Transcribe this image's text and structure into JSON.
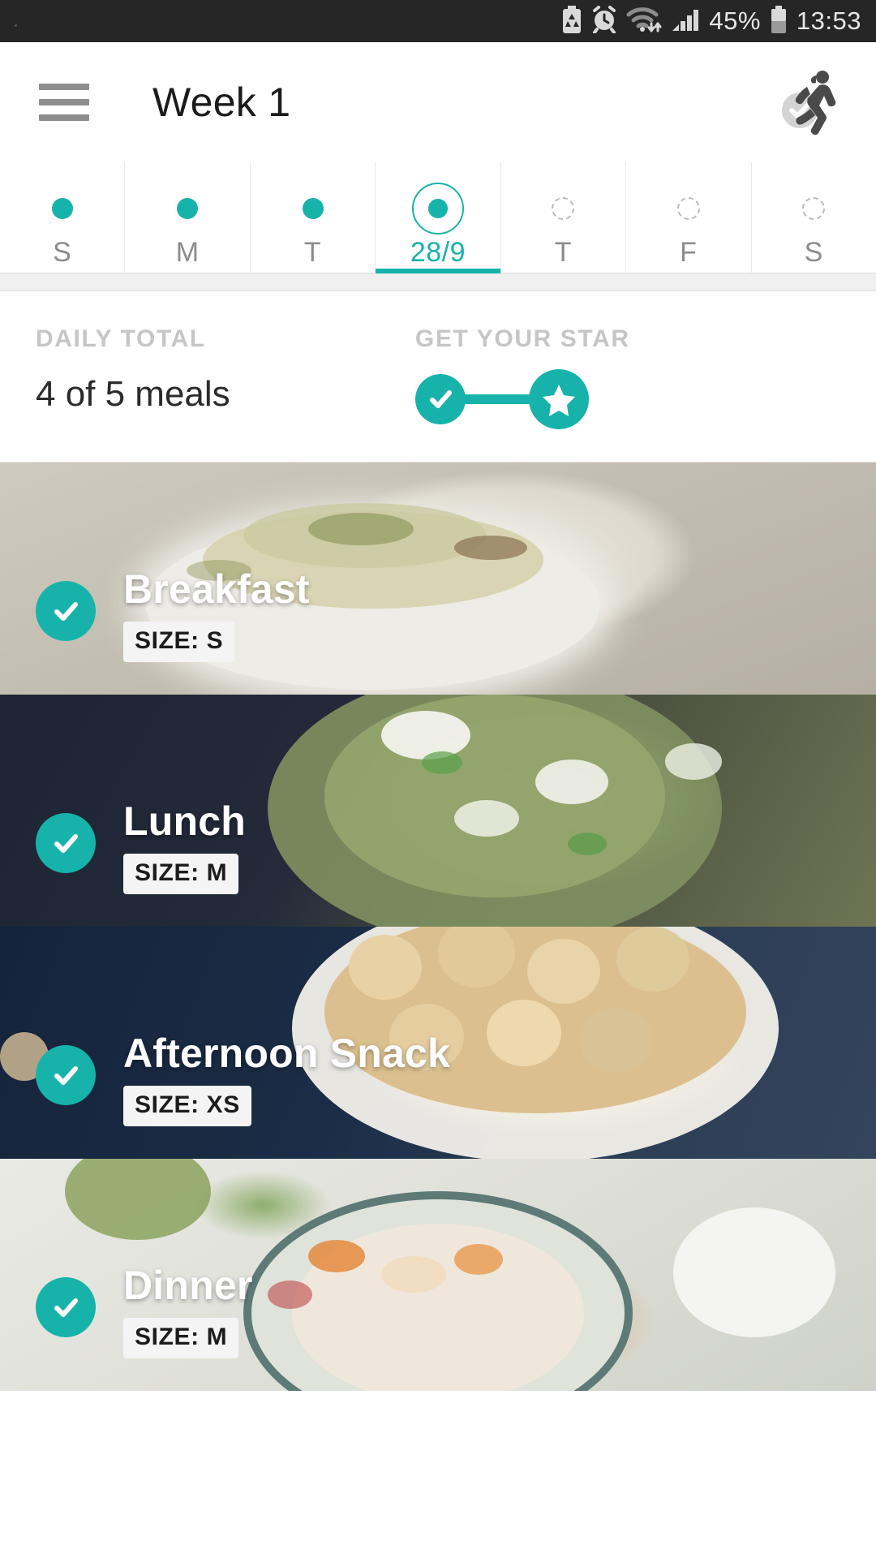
{
  "status_bar": {
    "icons": [
      "battery-saver-icon",
      "alarm-clock-icon",
      "wifi-icon",
      "signal-bars-icon",
      "battery-icon"
    ],
    "battery_percent": "45%",
    "time": "13:53"
  },
  "app_bar": {
    "menu_icon": "hamburger-menu-icon",
    "title": "Week 1",
    "action_icon": "running-person-icon"
  },
  "week_strip": {
    "days": [
      {
        "label": "S",
        "state": "complete",
        "selected": false
      },
      {
        "label": "M",
        "state": "complete",
        "selected": false
      },
      {
        "label": "T",
        "state": "complete",
        "selected": false
      },
      {
        "label": "28/9",
        "state": "complete",
        "selected": true
      },
      {
        "label": "T",
        "state": "empty",
        "selected": false
      },
      {
        "label": "F",
        "state": "empty",
        "selected": false
      },
      {
        "label": "S",
        "state": "empty",
        "selected": false
      }
    ]
  },
  "summary": {
    "daily_total_label": "DAILY TOTAL",
    "daily_total_value": "4 of 5 meals",
    "star_label": "GET YOUR STAR",
    "star_progress_icons": [
      "check-circle-icon",
      "star-circle-icon"
    ]
  },
  "meals": [
    {
      "name": "Breakfast",
      "size": "SIZE: S",
      "checked": true,
      "photo": "zucchini-gratin-photo"
    },
    {
      "name": "Lunch",
      "size": "SIZE: M",
      "checked": true,
      "photo": "zucchini-noodle-feta-photo"
    },
    {
      "name": "Afternoon Snack",
      "size": "SIZE: XS",
      "checked": true,
      "photo": "chickpeas-bowl-photo"
    },
    {
      "name": "Dinner",
      "size": "SIZE: M",
      "checked": true,
      "photo": "vegetable-salad-photo"
    }
  ],
  "colors": {
    "accent": "#17b3ab",
    "status_bar_bg": "#262626",
    "text_primary": "#2b2b2b",
    "text_muted": "#8c8c8c",
    "label_muted": "#c6c6c6"
  }
}
